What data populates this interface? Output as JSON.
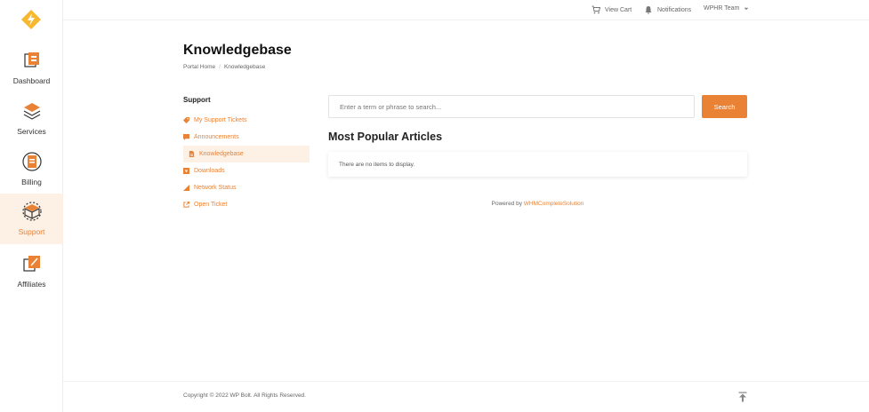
{
  "nav": {
    "items": [
      {
        "label": "Dashboard",
        "icon": "dashboard-icon"
      },
      {
        "label": "Services",
        "icon": "services-icon"
      },
      {
        "label": "Billing",
        "icon": "billing-icon"
      },
      {
        "label": "Support",
        "icon": "support-icon",
        "active": true
      },
      {
        "label": "Affiliates",
        "icon": "affiliates-icon"
      }
    ]
  },
  "topbar": {
    "cart": "View Cart",
    "notifications": "Notifications",
    "user": "WPHR Team"
  },
  "page": {
    "title": "Knowledgebase",
    "breadcrumb": [
      "Portal Home",
      "Knowledgebase"
    ]
  },
  "support": {
    "title": "Support",
    "items": [
      {
        "label": "My Support Tickets",
        "icon": "ticket-icon"
      },
      {
        "label": "Announcements",
        "icon": "announcement-icon"
      },
      {
        "label": "Knowledgebase",
        "icon": "document-icon",
        "active": true
      },
      {
        "label": "Downloads",
        "icon": "download-icon"
      },
      {
        "label": "Network Status",
        "icon": "network-status-icon"
      },
      {
        "label": "Open Ticket",
        "icon": "external-link-icon"
      }
    ]
  },
  "search": {
    "placeholder": "Enter a term or phrase to search...",
    "button": "Search"
  },
  "articles": {
    "title": "Most Popular Articles",
    "empty": "There are no items to display."
  },
  "powered": {
    "prefix": "Powered by",
    "link": "WHMCompleteSolution"
  },
  "footer": {
    "copyright": "Copyright © 2022 WP Bolt. All Rights Reserved."
  },
  "colors": {
    "accent": "#e98234",
    "active_bg": "#fdf0e4"
  }
}
